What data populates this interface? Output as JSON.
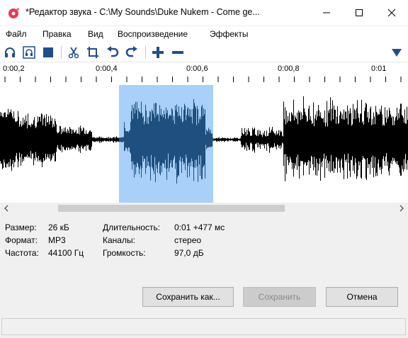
{
  "window": {
    "title": "*Редактор звука - C:\\My Sounds\\Duke Nukem - Come ge...",
    "accent_color": "#e8384f"
  },
  "menu": [
    {
      "label": "Файл"
    },
    {
      "label": "Правка"
    },
    {
      "label": "Вид"
    },
    {
      "label": "Воспроизведение"
    },
    {
      "label": "Эффекты"
    }
  ],
  "toolbar": {
    "icons": [
      "headphones-icon",
      "headphones-selection-icon",
      "stop-icon",
      "cut-icon",
      "crop-icon",
      "undo-icon",
      "redo-icon",
      "zoom-in-icon",
      "zoom-out-icon",
      "dropdown-arrow-icon"
    ],
    "icon_color": "#1f4e8c"
  },
  "ruler": {
    "ticks": [
      "0:00,2",
      "0:00,4",
      "0:00,6",
      "0:00,8",
      "0:01"
    ]
  },
  "waveform": {
    "wave_color": "#000000",
    "selection_color": "#a8d0f8",
    "selection_wave_color": "#1e4f7e"
  },
  "info": {
    "size_label": "Размер:",
    "size_value": "26 кБ",
    "format_label": "Формат:",
    "format_value": "MP3",
    "rate_label": "Частота:",
    "rate_value": "44100 Гц",
    "duration_label": "Длительность:",
    "duration_value": "0:01 +477 мс",
    "channels_label": "Каналы:",
    "channels_value": "стерео",
    "volume_label": "Громкость:",
    "volume_value": "97,0 дБ"
  },
  "buttons": {
    "save_as": "Сохранить как...",
    "save": "Сохранить",
    "cancel": "Отмена"
  }
}
